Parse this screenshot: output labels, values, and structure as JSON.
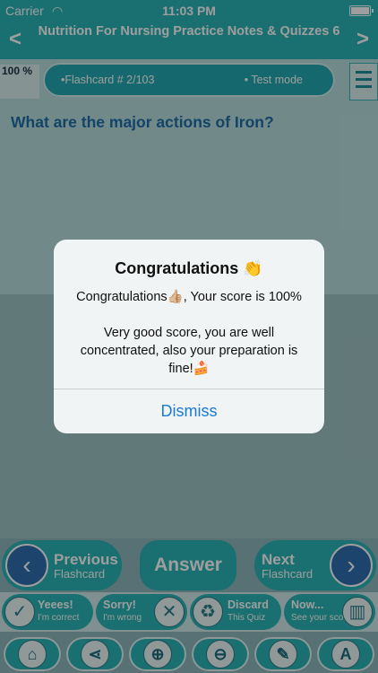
{
  "status_bar": {
    "carrier": "Carrier",
    "time": "11:03 PM"
  },
  "nav": {
    "title": "Nutrition For Nursing Practice Notes & Quizzes 6",
    "left_arrow": "<",
    "right_arrow": ">"
  },
  "progress": {
    "label": "100 %"
  },
  "card_info": {
    "flashcard": "•Flashcard # 2/103",
    "mode": "• Test mode"
  },
  "question": "What are the major actions of Iron?",
  "alert": {
    "title": "Congratulations 👏",
    "line1": "Congratulations👍🏼, Your score is 100%",
    "line2": "Very good score, you are well concentrated, also your preparation is fine!🍰",
    "button": "Dismiss"
  },
  "controls": {
    "previous": {
      "t1": "Previous",
      "t2": "Flashcard"
    },
    "answer": "Answer",
    "next": {
      "t1": "Next",
      "t2": "Flashcard"
    },
    "yes": {
      "a": "Yeees!",
      "b": "I'm correct"
    },
    "sorry": {
      "a": "Sorry!",
      "b": "I'm wrong"
    },
    "discard": {
      "a": "Discard",
      "b": "This Quiz"
    },
    "now": {
      "a": "Now...",
      "b": "See your score"
    }
  },
  "toolbar": [
    "home-icon",
    "share-icon",
    "zoom-in-icon",
    "zoom-out-icon",
    "bookmark-icon",
    "font-icon"
  ]
}
